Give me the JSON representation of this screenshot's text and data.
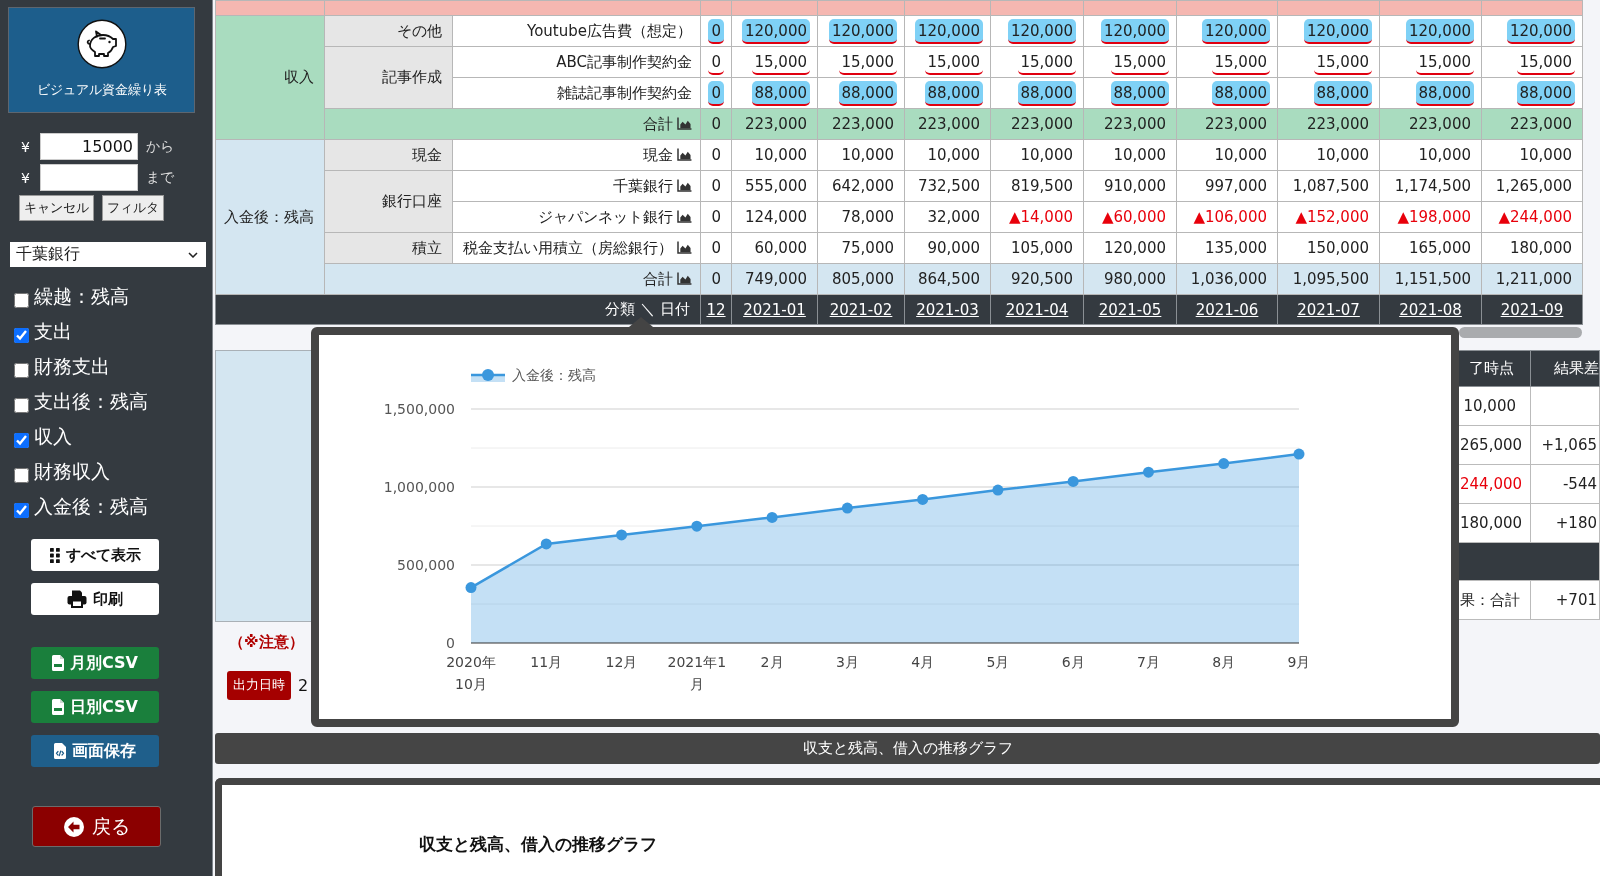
{
  "sidebar": {
    "app_title": "ビジュアル資金繰り表",
    "filter_rows": [
      {
        "currency": "¥",
        "value": "15000",
        "suffix": "から"
      },
      {
        "currency": "¥",
        "suffix": "まで"
      }
    ],
    "filter_buttons": [
      {
        "label": "キャンセル"
      },
      {
        "label": "フィルタ"
      }
    ],
    "account_select": {
      "value": "千葉銀行"
    },
    "toggles": [
      {
        "label": "繰越：残高",
        "checked": false
      },
      {
        "label": "支出",
        "checked": true
      },
      {
        "label": "財務支出",
        "checked": false
      },
      {
        "label": "支出後：残高",
        "checked": false
      },
      {
        "label": "収入",
        "checked": true
      },
      {
        "label": "財務収入",
        "checked": false
      },
      {
        "label": "入金後：残高",
        "checked": true
      }
    ],
    "actions": [
      {
        "kind": "show-all",
        "label": "すべて表示"
      },
      {
        "kind": "print",
        "label": "印刷"
      },
      {
        "kind": "csv",
        "label": "月別CSV"
      },
      {
        "kind": "csv",
        "label": "日別CSV"
      },
      {
        "kind": "save",
        "label": "画面保存"
      }
    ],
    "back_button": {
      "label": "戻る"
    }
  },
  "table": {
    "groups": [
      {
        "label": "収入",
        "color": "#a9dcbf",
        "sections": [
          {
            "label": "その他",
            "items": [
              {
                "label": "Youtube広告費（想定）",
                "chart_icon": false,
                "highlighted": true,
                "underlined": true,
                "values": [
                  {
                    "text": "0",
                    "negative": false
                  },
                  {
                    "text": "120,000",
                    "negative": false
                  },
                  {
                    "text": "120,000",
                    "negative": false
                  },
                  {
                    "text": "120,000",
                    "negative": false
                  },
                  {
                    "text": "120,000",
                    "negative": false
                  },
                  {
                    "text": "120,000",
                    "negative": false
                  },
                  {
                    "text": "120,000",
                    "negative": false
                  },
                  {
                    "text": "120,000",
                    "negative": false
                  },
                  {
                    "text": "120,000",
                    "negative": false
                  },
                  {
                    "text": "120,000",
                    "negative": false
                  }
                ]
              }
            ]
          },
          {
            "label": "記事作成",
            "items": [
              {
                "label": "ABC記事制作契約金",
                "chart_icon": false,
                "highlighted": false,
                "underlined": true,
                "values": [
                  {
                    "text": "0",
                    "negative": false
                  },
                  {
                    "text": "15,000",
                    "negative": false
                  },
                  {
                    "text": "15,000",
                    "negative": false
                  },
                  {
                    "text": "15,000",
                    "negative": false
                  },
                  {
                    "text": "15,000",
                    "negative": false
                  },
                  {
                    "text": "15,000",
                    "negative": false
                  },
                  {
                    "text": "15,000",
                    "negative": false
                  },
                  {
                    "text": "15,000",
                    "negative": false
                  },
                  {
                    "text": "15,000",
                    "negative": false
                  },
                  {
                    "text": "15,000",
                    "negative": false
                  }
                ]
              },
              {
                "label": "雑誌記事制作契約金",
                "chart_icon": false,
                "highlighted": true,
                "underlined": true,
                "values": [
                  {
                    "text": "0",
                    "negative": false
                  },
                  {
                    "text": "88,000",
                    "negative": false
                  },
                  {
                    "text": "88,000",
                    "negative": false
                  },
                  {
                    "text": "88,000",
                    "negative": false
                  },
                  {
                    "text": "88,000",
                    "negative": false
                  },
                  {
                    "text": "88,000",
                    "negative": false
                  },
                  {
                    "text": "88,000",
                    "negative": false
                  },
                  {
                    "text": "88,000",
                    "negative": false
                  },
                  {
                    "text": "88,000",
                    "negative": false
                  },
                  {
                    "text": "88,000",
                    "negative": false
                  }
                ]
              }
            ]
          }
        ],
        "total": {
          "label": "合計",
          "chart_icon": true,
          "values": [
            {
              "text": "0",
              "negative": false
            },
            {
              "text": "223,000",
              "negative": false
            },
            {
              "text": "223,000",
              "negative": false
            },
            {
              "text": "223,000",
              "negative": false
            },
            {
              "text": "223,000",
              "negative": false
            },
            {
              "text": "223,000",
              "negative": false
            },
            {
              "text": "223,000",
              "negative": false
            },
            {
              "text": "223,000",
              "negative": false
            },
            {
              "text": "223,000",
              "negative": false
            },
            {
              "text": "223,000",
              "negative": false
            }
          ]
        }
      },
      {
        "label": "入金後：残高",
        "color": "#d4e6f1",
        "sections": [
          {
            "label": "現金",
            "items": [
              {
                "label": "現金",
                "chart_icon": true,
                "highlighted": false,
                "underlined": false,
                "values": [
                  {
                    "text": "0",
                    "negative": false
                  },
                  {
                    "text": "10,000",
                    "negative": false
                  },
                  {
                    "text": "10,000",
                    "negative": false
                  },
                  {
                    "text": "10,000",
                    "negative": false
                  },
                  {
                    "text": "10,000",
                    "negative": false
                  },
                  {
                    "text": "10,000",
                    "negative": false
                  },
                  {
                    "text": "10,000",
                    "negative": false
                  },
                  {
                    "text": "10,000",
                    "negative": false
                  },
                  {
                    "text": "10,000",
                    "negative": false
                  },
                  {
                    "text": "10,000",
                    "negative": false
                  }
                ]
              }
            ]
          },
          {
            "label": "銀行口座",
            "items": [
              {
                "label": "千葉銀行",
                "chart_icon": true,
                "highlighted": false,
                "underlined": false,
                "values": [
                  {
                    "text": "0",
                    "negative": false
                  },
                  {
                    "text": "555,000",
                    "negative": false
                  },
                  {
                    "text": "642,000",
                    "negative": false
                  },
                  {
                    "text": "732,500",
                    "negative": false
                  },
                  {
                    "text": "819,500",
                    "negative": false
                  },
                  {
                    "text": "910,000",
                    "negative": false
                  },
                  {
                    "text": "997,000",
                    "negative": false
                  },
                  {
                    "text": "1,087,500",
                    "negative": false
                  },
                  {
                    "text": "1,174,500",
                    "negative": false
                  },
                  {
                    "text": "1,265,000",
                    "negative": false
                  }
                ]
              },
              {
                "label": "ジャパンネット銀行",
                "chart_icon": true,
                "highlighted": false,
                "underlined": false,
                "values": [
                  {
                    "text": "0",
                    "negative": false
                  },
                  {
                    "text": "124,000",
                    "negative": false
                  },
                  {
                    "text": "78,000",
                    "negative": false
                  },
                  {
                    "text": "32,000",
                    "negative": false
                  },
                  {
                    "text": "▲14,000",
                    "negative": true
                  },
                  {
                    "text": "▲60,000",
                    "negative": true
                  },
                  {
                    "text": "▲106,000",
                    "negative": true
                  },
                  {
                    "text": "▲152,000",
                    "negative": true
                  },
                  {
                    "text": "▲198,000",
                    "negative": true
                  },
                  {
                    "text": "▲244,000",
                    "negative": true
                  }
                ]
              }
            ]
          },
          {
            "label": "積立",
            "items": [
              {
                "label": "税金支払い用積立（房総銀行）",
                "chart_icon": true,
                "highlighted": false,
                "underlined": false,
                "values": [
                  {
                    "text": "0",
                    "negative": false
                  },
                  {
                    "text": "60,000",
                    "negative": false
                  },
                  {
                    "text": "75,000",
                    "negative": false
                  },
                  {
                    "text": "90,000",
                    "negative": false
                  },
                  {
                    "text": "105,000",
                    "negative": false
                  },
                  {
                    "text": "120,000",
                    "negative": false
                  },
                  {
                    "text": "135,000",
                    "negative": false
                  },
                  {
                    "text": "150,000",
                    "negative": false
                  },
                  {
                    "text": "165,000",
                    "negative": false
                  },
                  {
                    "text": "180,000",
                    "negative": false
                  }
                ]
              }
            ]
          }
        ],
        "total": {
          "label": "合計",
          "chart_icon": true,
          "values": [
            {
              "text": "0",
              "negative": false
            },
            {
              "text": "749,000",
              "negative": false
            },
            {
              "text": "805,000",
              "negative": false
            },
            {
              "text": "864,500",
              "negative": false
            },
            {
              "text": "920,500",
              "negative": false
            },
            {
              "text": "980,000",
              "negative": false
            },
            {
              "text": "1,036,000",
              "negative": false
            },
            {
              "text": "1,095,500",
              "negative": false
            },
            {
              "text": "1,151,500",
              "negative": false
            },
            {
              "text": "1,211,000",
              "negative": false
            }
          ]
        }
      }
    ],
    "header": {
      "label": "分類 ＼ 日付",
      "dates": [
        "12",
        "2021-01",
        "2021-02",
        "2021-03",
        "2021-04",
        "2021-05",
        "2021-06",
        "2021-07",
        "2021-08",
        "2021-09"
      ]
    }
  },
  "results_table": {
    "rows": [
      {
        "kind": "header",
        "cells": [
          {
            "text": "了時点"
          },
          {
            "text": "結果差"
          }
        ]
      },
      {
        "kind": "data",
        "cells": [
          {
            "text": "10,000",
            "negative": false
          }
        ]
      },
      {
        "kind": "data",
        "cells": [
          {
            "text": "265,000",
            "negative": false
          },
          {
            "text": "+1,065",
            "negative": false
          }
        ]
      },
      {
        "kind": "data",
        "cells": [
          {
            "text": "244,000",
            "negative": true
          },
          {
            "text": "-544",
            "negative": false
          }
        ]
      },
      {
        "kind": "data",
        "cells": [
          {
            "text": "180,000",
            "negative": false
          },
          {
            "text": "+180",
            "negative": false
          }
        ]
      },
      {
        "kind": "band"
      },
      {
        "kind": "data",
        "cells": [
          {
            "text": "果：合計",
            "negative": false
          },
          {
            "text": "+701",
            "negative": false
          }
        ]
      }
    ]
  },
  "note": {
    "text": "（※注意）"
  },
  "output_time": {
    "label": "出力日時",
    "value": "2"
  },
  "graph_bar": {
    "title": "収支と残高、借入の推移グラフ"
  },
  "graph_card": {
    "title": "収支と残高、借入の推移グラフ"
  },
  "chart_popup": {
    "chart_data": {
      "type": "area",
      "categories": [
        "2020年10月",
        "11月",
        "12月",
        "2021年1月",
        "2月",
        "3月",
        "4月",
        "5月",
        "6月",
        "7月",
        "8月",
        "9月"
      ],
      "series": [
        {
          "name": "入金後：残高",
          "color": "#3a97dd",
          "values": [
            355000,
            635000,
            693000,
            749000,
            805000,
            865000,
            920000,
            980000,
            1036000,
            1095000,
            1150000,
            1211000
          ]
        }
      ],
      "ylim": [
        0,
        1500000
      ],
      "yticks": [
        {
          "value": 0,
          "label": "0"
        },
        {
          "value": 500000,
          "label": "500,000"
        },
        {
          "value": 1000000,
          "label": "1,000,000"
        },
        {
          "value": 1500000,
          "label": "1,500,000"
        }
      ]
    }
  }
}
